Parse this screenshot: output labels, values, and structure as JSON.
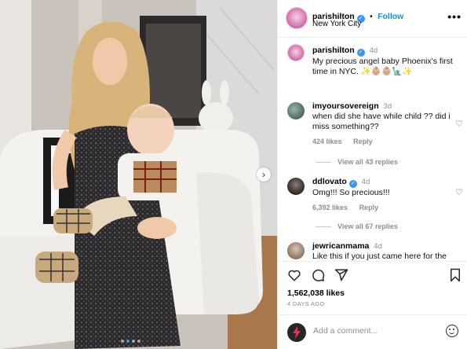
{
  "post": {
    "carousel_count": 4,
    "carousel_active": 2
  },
  "header": {
    "username": "parishilton",
    "follow_label": "Follow",
    "separator": "•",
    "location": "New York City",
    "more_glyph": "•••"
  },
  "caption": {
    "username": "parishilton",
    "time": "4d",
    "text": "My precious angel baby Phoenix's first time in NYC. ✨👶🏼👶🏼🗽✨"
  },
  "comments": [
    {
      "username": "imyoursovereign",
      "time": "3d",
      "text": "when did she have while child ?? did i miss something??",
      "likes": "424 likes",
      "reply_label": "Reply",
      "view_replies": "View all 43 replies"
    },
    {
      "username": "ddlovato",
      "time": "4d",
      "text": "Omg!!! So precious!!!",
      "likes": "6,392 likes",
      "reply_label": "Reply",
      "view_replies": "View all 67 replies"
    },
    {
      "username": "jewricanmama",
      "time": "4d",
      "text": "Like this if you just came here for the"
    }
  ],
  "actions": {
    "likes_count": "1,562,038 likes",
    "date": "4 DAYS AGO"
  },
  "add_comment": {
    "placeholder": "Add a comment..."
  },
  "icons": {
    "verified": "verified-badge-icon",
    "heart": "heart-icon",
    "comment": "comment-bubble-icon",
    "share": "paper-plane-icon",
    "save": "bookmark-icon",
    "emoji": "emoji-smiley-icon",
    "next": "chevron-right-icon"
  },
  "colors": {
    "accent": "#0095f6",
    "verified": "#3897f0",
    "muted": "#8e8e8e"
  }
}
